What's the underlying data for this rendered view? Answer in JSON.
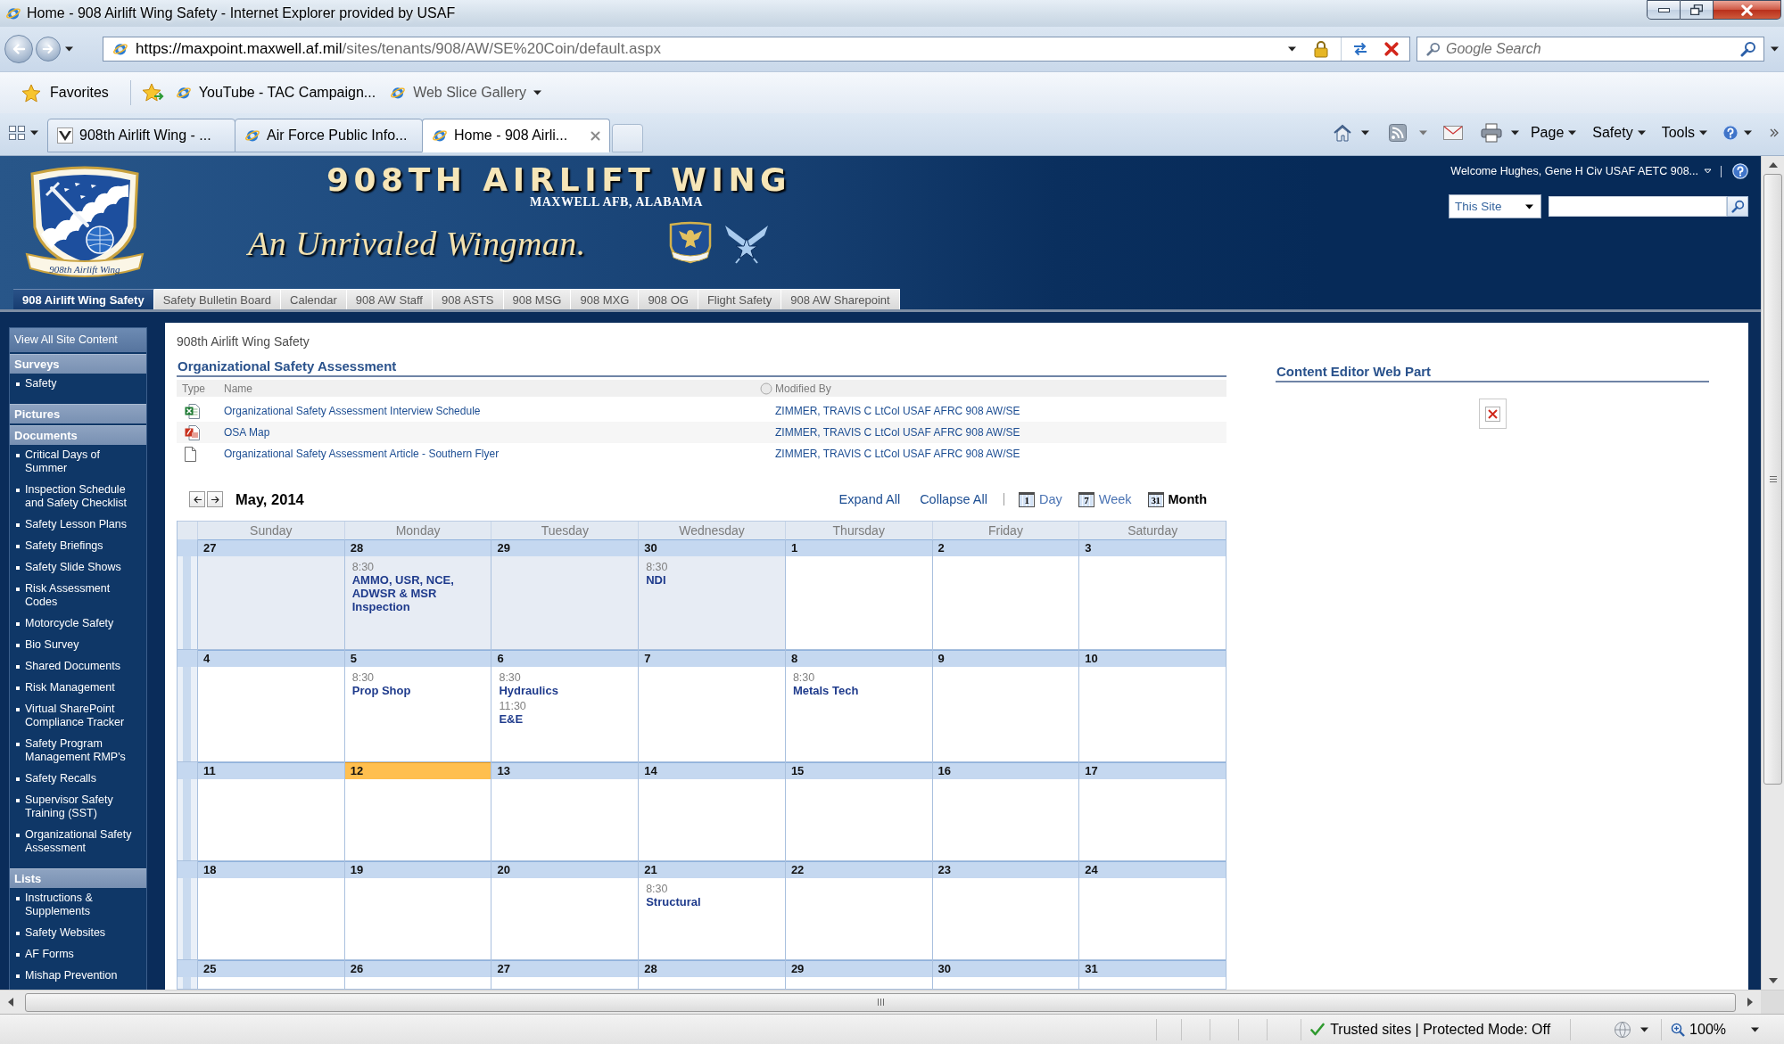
{
  "window": {
    "title": "Home - 908 Airlift Wing Safety - Internet Explorer provided by USAF"
  },
  "address_bar": {
    "url": "https://maxpoint.maxwell.af.mil/sites/tenants/908/AW/SE%20Coin/default.aspx"
  },
  "search_box": {
    "placeholder": "Google Search"
  },
  "favorites_bar": {
    "favorites": "Favorites",
    "items": [
      {
        "kind": "link",
        "label": "YouTube - TAC Campaign..."
      },
      {
        "kind": "gallery",
        "label": "Web Slice Gallery"
      }
    ]
  },
  "tabs": [
    {
      "kind": "site",
      "label": "908th Airlift Wing - ...",
      "selected": false
    },
    {
      "kind": "browser",
      "label": "Air Force Public Info...",
      "selected": false
    },
    {
      "kind": "browser",
      "label": "Home - 908 Airli...",
      "selected": true
    }
  ],
  "command_bar": {
    "menus": [
      "Page",
      "Safety",
      "Tools"
    ]
  },
  "site_header": {
    "title": "908TH AIRLIFT WING",
    "location": "MAXWELL AFB, ALABAMA",
    "motto": "An Unrivaled Wingman.",
    "logo_ribbon": "908th Airlift Wing",
    "welcome": "Welcome Hughes, Gene H Civ USAF AETC 908...",
    "search_scope": "This Site"
  },
  "top_nav": [
    {
      "label": "908 Airlift Wing Safety",
      "selected": true
    },
    {
      "label": "Safety Bulletin Board",
      "selected": false
    },
    {
      "label": "Calendar",
      "selected": false
    },
    {
      "label": "908 AW Staff",
      "selected": false
    },
    {
      "label": "908 ASTS",
      "selected": false
    },
    {
      "label": "908 MSG",
      "selected": false
    },
    {
      "label": "908 MXG",
      "selected": false
    },
    {
      "label": "908 OG",
      "selected": false
    },
    {
      "label": "Flight Safety",
      "selected": false
    },
    {
      "label": "908 AW Sharepoint",
      "selected": false
    }
  ],
  "quick_launch": {
    "view_all": "View All Site Content",
    "sections": [
      {
        "heading": "Surveys",
        "items": [
          "Safety"
        ]
      },
      {
        "heading": "Pictures"
      },
      {
        "heading": "Documents",
        "items": [
          "Critical Days of Summer",
          "Inspection Schedule and Safety Checklist",
          "Safety Lesson Plans",
          "Safety Briefings",
          "Safety Slide Shows",
          "Risk Assessment Codes",
          "Motorcycle Safety",
          "Bio Survey",
          "Shared Documents",
          "Risk Management",
          "Virtual SharePoint Compliance Tracker",
          "Safety Program Management RMP's",
          "Safety Recalls",
          "Supervisor Safety Training (SST)",
          "Organizational Safety Assessment"
        ]
      },
      {
        "heading": "Lists",
        "items": [
          "Instructions & Supplements",
          "Safety Websites",
          "AF Forms",
          "Mishap Prevention"
        ]
      }
    ]
  },
  "breadcrumb": "908th Airlift Wing Safety",
  "document_library": {
    "title": "Organizational Safety Assessment",
    "columns": [
      "Type",
      "Name",
      "Modified By"
    ],
    "rows": [
      {
        "kind": "spreadsheet",
        "name": "Organizational Safety Assessment Interview Schedule",
        "modified_by": "ZIMMER, TRAVIS C LtCol USAF AFRC 908 AW/SE"
      },
      {
        "kind": "pdf",
        "name": "OSA Map",
        "modified_by": "ZIMMER, TRAVIS C LtCol USAF AFRC 908 AW/SE"
      },
      {
        "kind": "generic",
        "name": "Organizational Safety Assessment Article - Southern Flyer",
        "modified_by": "ZIMMER, TRAVIS C LtCol USAF AFRC 908 AW/SE"
      }
    ]
  },
  "calendar": {
    "month": "May, 2014",
    "actions": [
      "Expand All",
      "Collapse All"
    ],
    "views": [
      {
        "icon_text": "1",
        "label": "Day",
        "selected": false
      },
      {
        "icon_text": "7",
        "label": "Week",
        "selected": false
      },
      {
        "icon_text": "31",
        "label": "Month",
        "selected": true
      }
    ],
    "weekdays": [
      "Sunday",
      "Monday",
      "Tuesday",
      "Wednesday",
      "Thursday",
      "Friday",
      "Saturday"
    ],
    "weeks": [
      {
        "days": [
          {
            "date": "27",
            "in_month": false,
            "today": false
          },
          {
            "date": "28",
            "in_month": false,
            "today": false,
            "events": [
              {
                "time": "8:30",
                "title": "AMMO, USR, NCE, ADWSR & MSR Inspection"
              }
            ]
          },
          {
            "date": "29",
            "in_month": false,
            "today": false
          },
          {
            "date": "30",
            "in_month": false,
            "today": false,
            "events": [
              {
                "time": "8:30",
                "title": "NDI"
              }
            ]
          },
          {
            "date": "1",
            "in_month": true,
            "today": false
          },
          {
            "date": "2",
            "in_month": true,
            "today": false
          },
          {
            "date": "3",
            "in_month": true,
            "today": false
          }
        ]
      },
      {
        "days": [
          {
            "date": "4",
            "in_month": true,
            "today": false
          },
          {
            "date": "5",
            "in_month": true,
            "today": false,
            "events": [
              {
                "time": "8:30",
                "title": "Prop Shop"
              }
            ]
          },
          {
            "date": "6",
            "in_month": true,
            "today": false,
            "events": [
              {
                "time": "8:30",
                "title": "Hydraulics"
              },
              {
                "time": "11:30",
                "title": "E&E"
              }
            ]
          },
          {
            "date": "7",
            "in_month": true,
            "today": false
          },
          {
            "date": "8",
            "in_month": true,
            "today": false,
            "events": [
              {
                "time": "8:30",
                "title": "Metals Tech"
              }
            ]
          },
          {
            "date": "9",
            "in_month": true,
            "today": false
          },
          {
            "date": "10",
            "in_month": true,
            "today": false
          }
        ]
      },
      {
        "days": [
          {
            "date": "11",
            "in_month": true,
            "today": false
          },
          {
            "date": "12",
            "in_month": true,
            "today": true
          },
          {
            "date": "13",
            "in_month": true,
            "today": false
          },
          {
            "date": "14",
            "in_month": true,
            "today": false
          },
          {
            "date": "15",
            "in_month": true,
            "today": false
          },
          {
            "date": "16",
            "in_month": true,
            "today": false
          },
          {
            "date": "17",
            "in_month": true,
            "today": false
          }
        ]
      },
      {
        "days": [
          {
            "date": "18",
            "in_month": true,
            "today": false
          },
          {
            "date": "19",
            "in_month": true,
            "today": false
          },
          {
            "date": "20",
            "in_month": true,
            "today": false
          },
          {
            "date": "21",
            "in_month": true,
            "today": false,
            "events": [
              {
                "time": "8:30",
                "title": "Structural"
              }
            ]
          },
          {
            "date": "22",
            "in_month": true,
            "today": false
          },
          {
            "date": "23",
            "in_month": true,
            "today": false
          },
          {
            "date": "24",
            "in_month": true,
            "today": false
          }
        ]
      },
      {
        "days": [
          {
            "date": "25",
            "in_month": true,
            "today": false
          },
          {
            "date": "26",
            "in_month": true,
            "today": false
          },
          {
            "date": "27",
            "in_month": true,
            "today": false
          },
          {
            "date": "28",
            "in_month": true,
            "today": false
          },
          {
            "date": "29",
            "in_month": true,
            "today": false
          },
          {
            "date": "30",
            "in_month": true,
            "today": false
          },
          {
            "date": "31",
            "in_month": true,
            "today": false
          }
        ]
      }
    ]
  },
  "content_editor": {
    "title": "Content Editor Web Part"
  },
  "status_bar": {
    "zone": "Trusted sites | Protected Mode: Off",
    "zoom": "100%"
  }
}
